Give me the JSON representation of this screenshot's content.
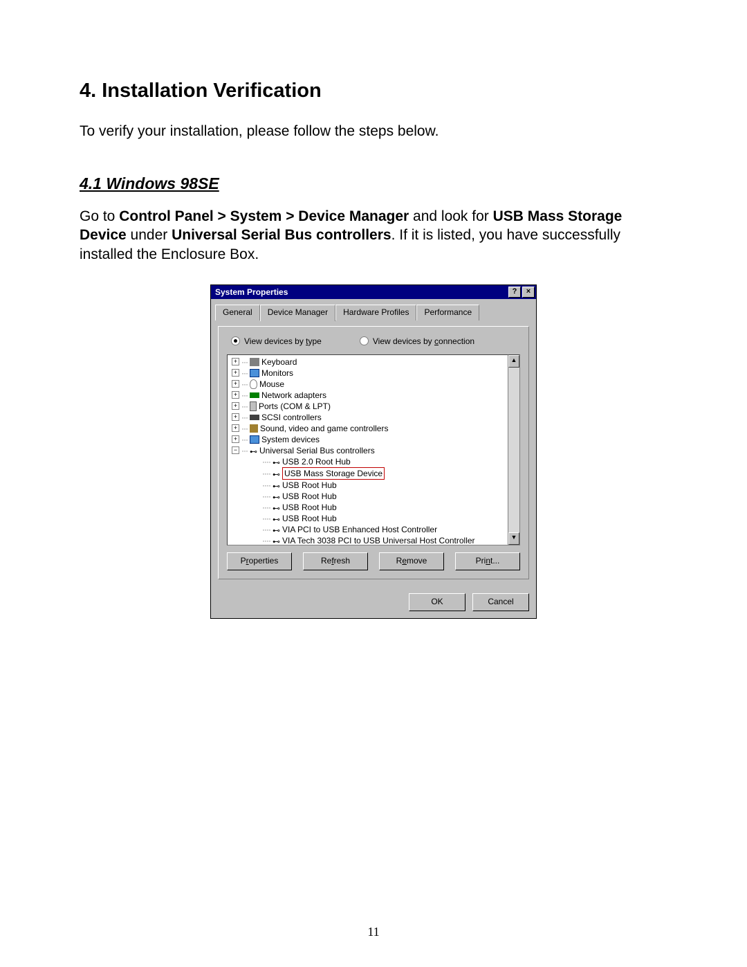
{
  "heading": "4. Installation Verification",
  "intro": "To verify your installation, please follow the steps below.",
  "sub_heading": "4.1 Windows 98SE",
  "para_prefix": "Go to ",
  "para_bold1": "Control Panel > System > Device Manager",
  "para_mid1": " and look for ",
  "para_bold2": "USB Mass Storage Device",
  "para_mid2": " under ",
  "para_bold3": "Universal Serial Bus controllers",
  "para_tail": ". If it is listed, you have successfully installed the Enclosure Box.",
  "dialog": {
    "title": "System Properties",
    "help_btn": "?",
    "close_btn": "×",
    "tabs": {
      "general": "General",
      "device_manager": "Device Manager",
      "hardware_profiles": "Hardware Profiles",
      "performance": "Performance"
    },
    "radio": {
      "by_type_pre": "View devices by ",
      "by_type_u": "t",
      "by_type_post": "ype",
      "by_conn_pre": "View devices by ",
      "by_conn_u": "c",
      "by_conn_post": "onnection"
    },
    "tree": {
      "keyboard": "Keyboard",
      "monitors": "Monitors",
      "mouse": "Mouse",
      "network": "Network adapters",
      "ports": "Ports (COM & LPT)",
      "scsi": "SCSI controllers",
      "sound": "Sound, video and game controllers",
      "system": "System devices",
      "usb_ctrl": "Universal Serial Bus controllers",
      "usb20hub": "USB 2.0 Root Hub",
      "usb_mass": "USB Mass Storage Device",
      "usb_root1": "USB Root Hub",
      "usb_root2": "USB Root Hub",
      "usb_root3": "USB Root Hub",
      "usb_root4": "USB Root Hub",
      "via_enh": "VIA PCI to USB Enhanced Host Controller",
      "via_partial": "VIA Tech 3038 PCI to USB Universal Host Controller"
    },
    "buttons": {
      "properties_pre": "P",
      "properties_u": "r",
      "properties_post": "operties",
      "refresh_pre": "Re",
      "refresh_u": "f",
      "refresh_post": "resh",
      "remove_pre": "R",
      "remove_u": "e",
      "remove_post": "move",
      "print_pre": "Pri",
      "print_u": "n",
      "print_post": "t..."
    },
    "ok": "OK",
    "cancel": "Cancel"
  },
  "page_number": "11"
}
